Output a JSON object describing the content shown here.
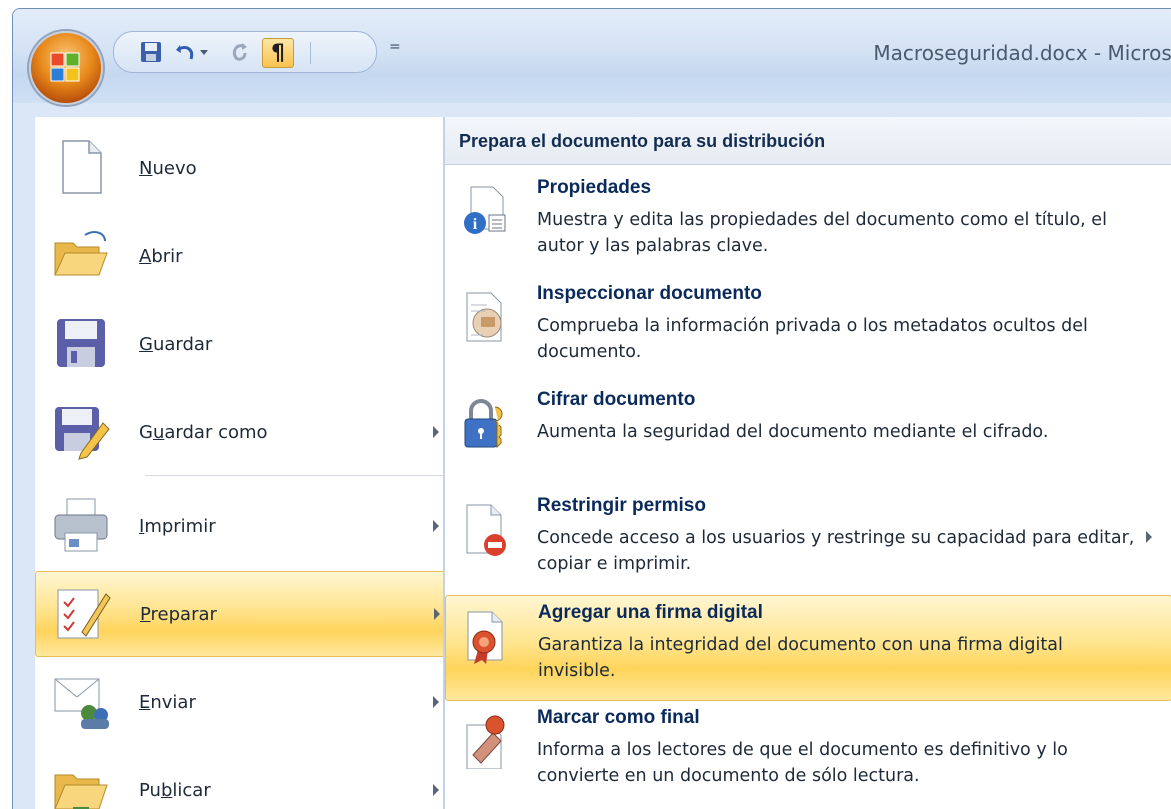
{
  "window": {
    "title": "Macroseguridad.docx - Microso"
  },
  "qat": {
    "icons": [
      "save-icon",
      "undo-icon",
      "undo-dropdown-icon",
      "redo-icon",
      "paragraph-mark-icon",
      "customize-qat-icon"
    ],
    "paragraph_symbol": "¶",
    "customize_symbol": "="
  },
  "left_menu": {
    "items": [
      {
        "key": "N",
        "rest": "uevo",
        "pre": "",
        "icon": "new-document-icon",
        "submenu": false
      },
      {
        "key": "A",
        "rest": "brir",
        "pre": "",
        "icon": "open-folder-icon",
        "submenu": false
      },
      {
        "key": "G",
        "rest": "uardar",
        "pre": "",
        "icon": "save-floppy-icon",
        "submenu": false
      },
      {
        "pre": "G",
        "key": "u",
        "rest": "ardar como",
        "icon": "save-as-icon",
        "submenu": true
      },
      {
        "pre": "",
        "key": "I",
        "rest": "mprimir",
        "icon": "printer-icon",
        "submenu": true
      },
      {
        "pre": "",
        "key": "P",
        "rest": "reparar",
        "icon": "prepare-icon",
        "submenu": true
      },
      {
        "pre": "",
        "key": "E",
        "rest": "nviar",
        "icon": "send-icon",
        "submenu": true
      },
      {
        "pre": "Pu",
        "key": "b",
        "rest": "licar",
        "icon": "publish-icon",
        "submenu": true
      }
    ]
  },
  "right_panel": {
    "header": "Prepara el documento para su distribución",
    "items": [
      {
        "title": "Propiedades",
        "desc": "Muestra y edita las propiedades del documento como el título, el autor y las palabras clave.",
        "icon": "properties-icon"
      },
      {
        "title": "Inspeccionar documento",
        "desc": "Comprueba la información privada o los metadatos ocultos del documento.",
        "icon": "inspect-document-icon"
      },
      {
        "title": "Cifrar documento",
        "desc": "Aumenta la seguridad del documento mediante el cifrado.",
        "icon": "encrypt-lock-icon"
      },
      {
        "title": "Restringir permiso",
        "desc": "Concede acceso a los usuarios y restringe su capacidad para editar, copiar e imprimir.",
        "icon": "restrict-permission-icon"
      },
      {
        "title": "Agregar una firma digital",
        "desc": "Garantiza la integridad del documento con una firma digital invisible.",
        "icon": "digital-signature-icon"
      },
      {
        "title": "Marcar como final",
        "desc": "Informa a los lectores de que el documento es definitivo y lo convierte en un documento de sólo lectura.",
        "icon": "mark-final-icon"
      }
    ]
  }
}
